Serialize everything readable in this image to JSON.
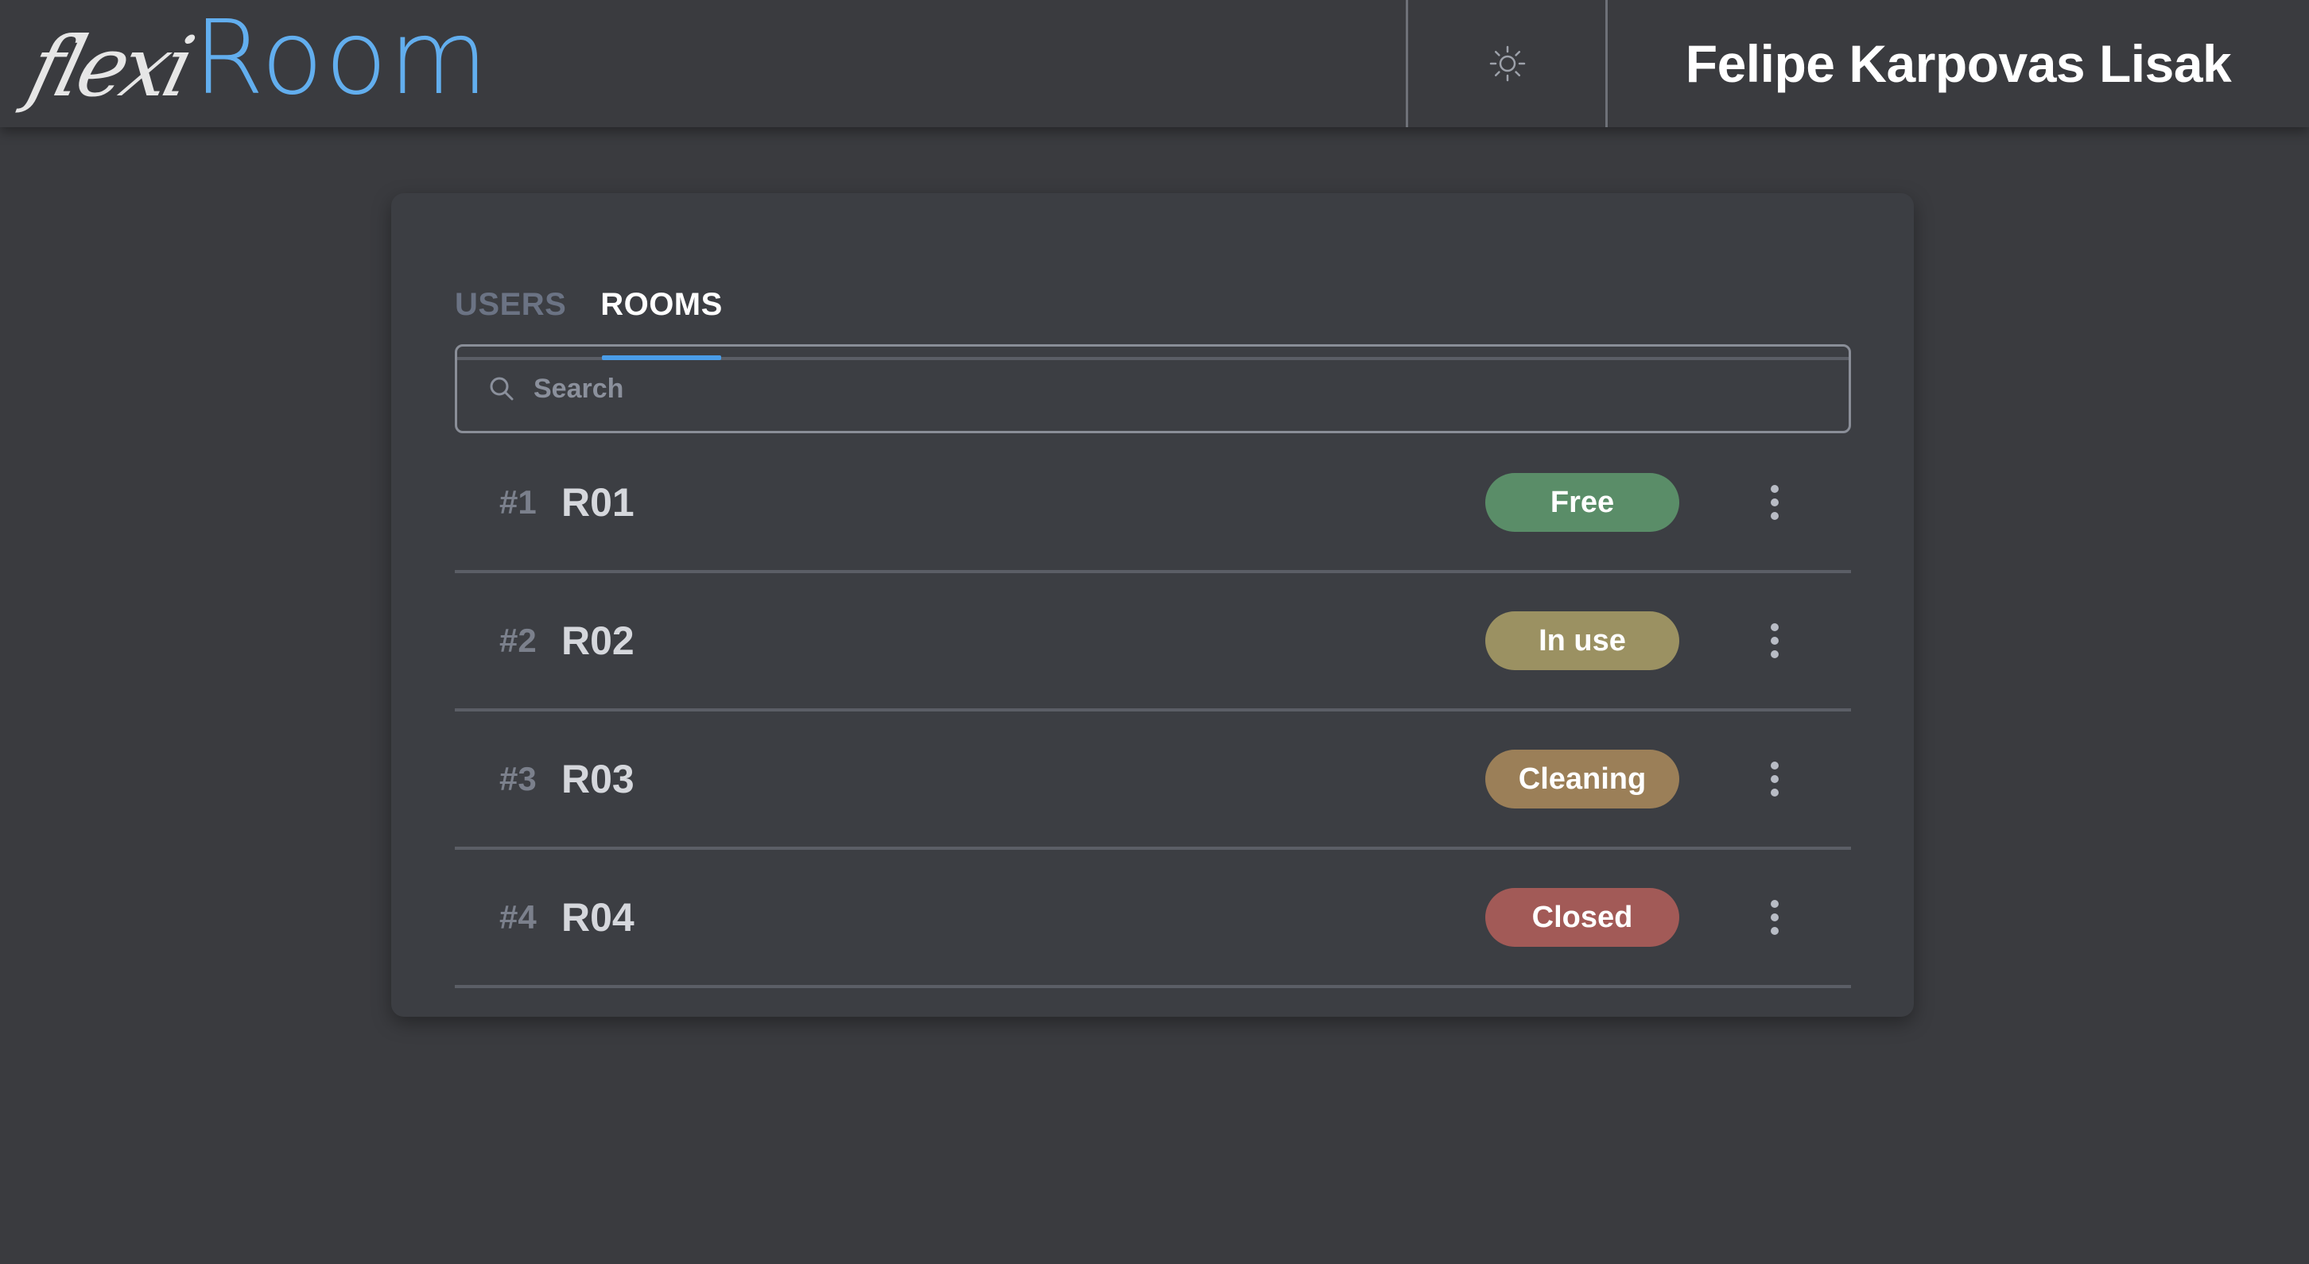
{
  "header": {
    "logo_script": "flexi",
    "logo_main": "Room",
    "theme_toggle_icon": "sun-icon",
    "user_name": "Felipe Karpovas Lisak"
  },
  "tabs": [
    {
      "label": "USERS",
      "active": false
    },
    {
      "label": "ROOMS",
      "active": true
    }
  ],
  "search": {
    "placeholder": "Search",
    "value": ""
  },
  "rooms": [
    {
      "index": "#1",
      "name": "R01",
      "status": "Free",
      "status_color": "#5a8d68"
    },
    {
      "index": "#2",
      "name": "R02",
      "status": "In use",
      "status_color": "#9b9162"
    },
    {
      "index": "#3",
      "name": "R03",
      "status": "Cleaning",
      "status_color": "#9b7f58"
    },
    {
      "index": "#4",
      "name": "R04",
      "status": "Closed",
      "status_color": "#a25a57"
    }
  ],
  "colors": {
    "accent": "#62aeee",
    "background": "#3a3b3f",
    "card": "#3c3e43"
  }
}
